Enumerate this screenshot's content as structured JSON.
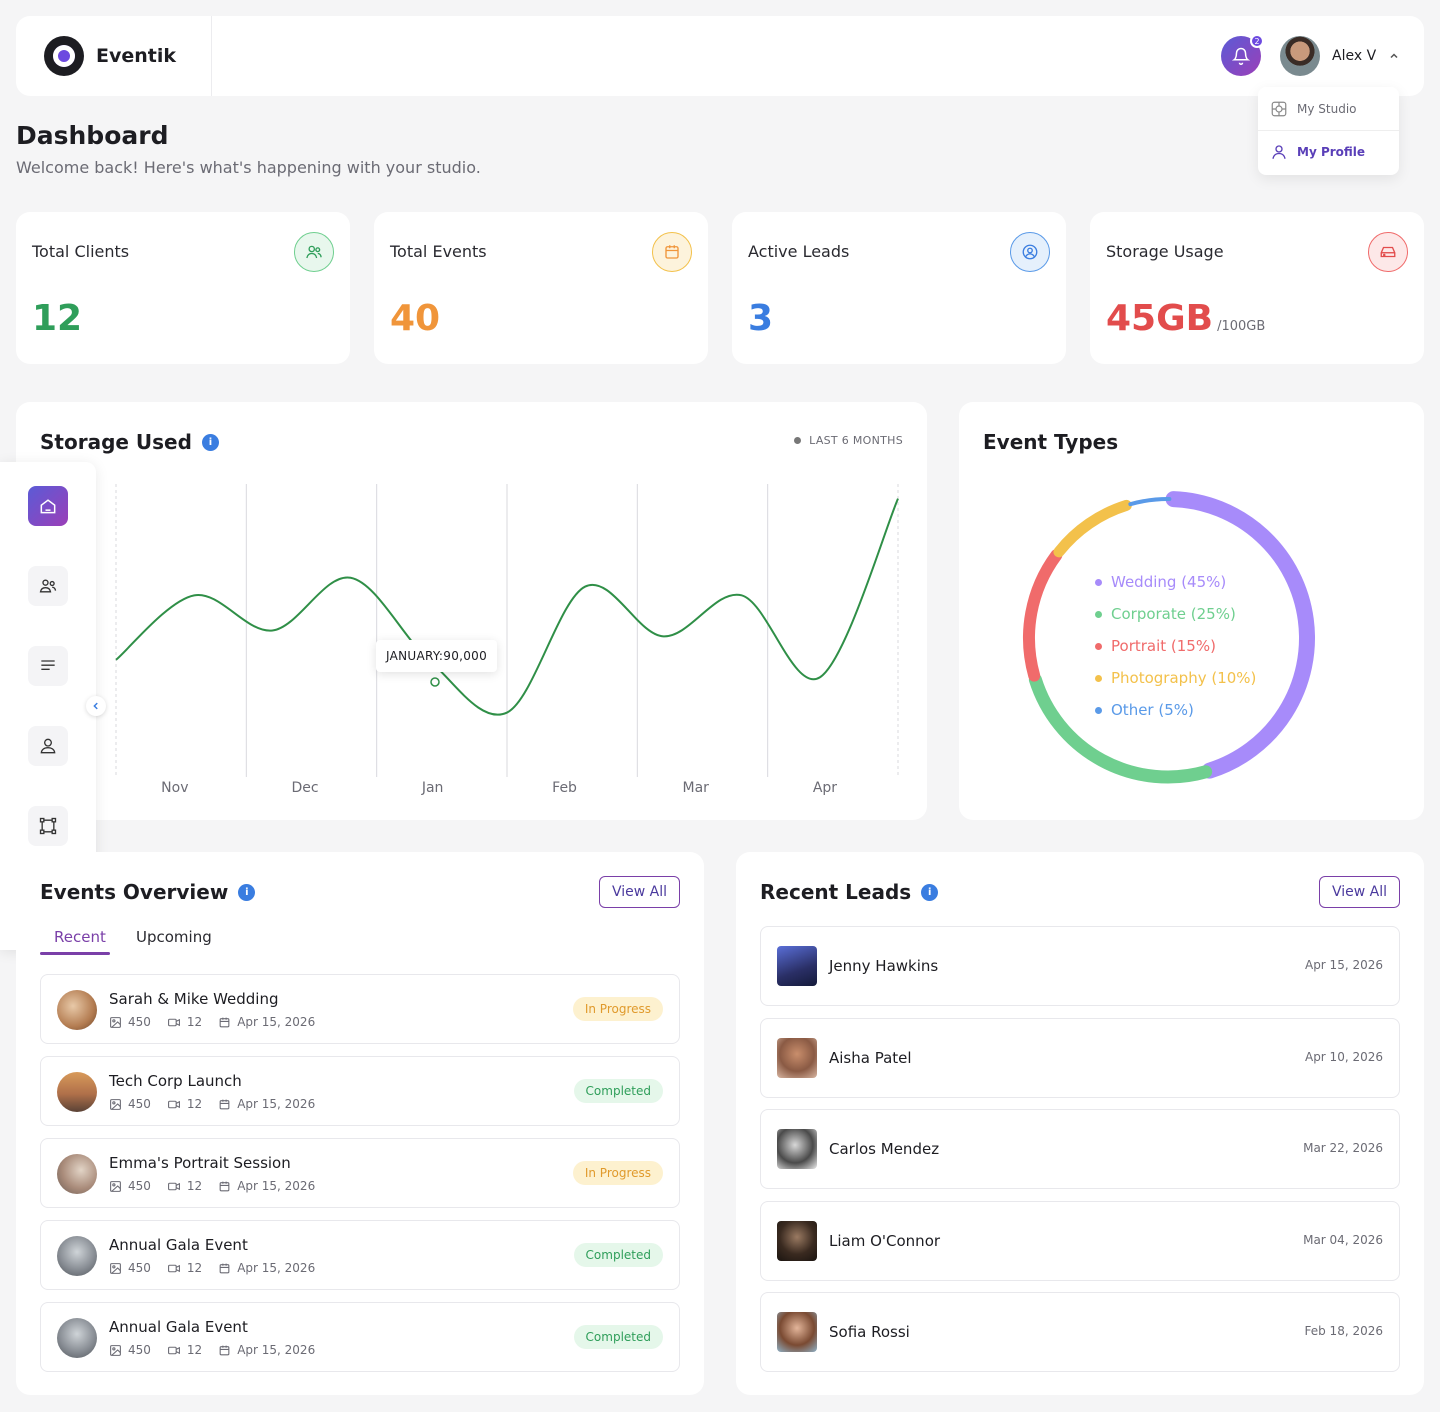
{
  "header": {
    "brand": "Eventik",
    "notification_count": "2",
    "user_name": "Alex V"
  },
  "user_menu": {
    "items": [
      {
        "label": "My Studio",
        "icon": "studio-icon"
      },
      {
        "label": "My Profile",
        "icon": "user-icon",
        "active": true
      }
    ]
  },
  "page": {
    "title": "Dashboard",
    "subtitle": "Welcome back! Here's what's happening with your studio."
  },
  "stats": [
    {
      "label": "Total Clients",
      "value": "12",
      "color": "#2f9e5a",
      "icon": "users-icon"
    },
    {
      "label": "Total Events",
      "value": "40",
      "color": "#f0953a",
      "icon": "calendar-icon"
    },
    {
      "label": "Active Leads",
      "value": "3",
      "color": "#3a7de0",
      "icon": "user-circle-icon"
    },
    {
      "label": "Storage Usage",
      "value": "45GB",
      "unit": "/100GB",
      "color": "#e24c4c",
      "icon": "drive-icon"
    }
  ],
  "storage": {
    "title": "Storage Used",
    "range_label": "LAST 6 MONTHS",
    "tooltip": "JANUARY:90,000"
  },
  "chart_data": {
    "type": "line",
    "title": "Storage Used",
    "categories": [
      "Nov",
      "Dec",
      "Jan",
      "Feb",
      "Mar",
      "Apr"
    ],
    "x": [
      0,
      0.5,
      1,
      1.5,
      2,
      2.5,
      3,
      3.5,
      4,
      4.5,
      5,
      5.5,
      6
    ],
    "y": [
      40,
      62,
      50,
      68,
      40,
      22,
      65,
      48,
      62,
      34,
      95
    ],
    "series_color": "#2f8f47",
    "grid": true,
    "highlight": {
      "category": "Jan",
      "label": "JANUARY:90,000"
    }
  },
  "event_types": {
    "title": "Event Types",
    "segments": [
      {
        "label": "Wedding (45%)",
        "value": 45,
        "color": "#a78bfa"
      },
      {
        "label": "Corporate (25%)",
        "value": 25,
        "color": "#6fcf8f"
      },
      {
        "label": "Portrait (15%)",
        "value": 15,
        "color": "#f06b6b"
      },
      {
        "label": "Photography (10%)",
        "value": 10,
        "color": "#f3c14b"
      },
      {
        "label": "Other (5%)",
        "value": 5,
        "color": "#5a9ae8"
      }
    ]
  },
  "sidebar": {
    "items": [
      {
        "name": "home-icon",
        "active": true
      },
      {
        "name": "clients-icon"
      },
      {
        "name": "menu-icon"
      },
      {
        "name": "profile-icon"
      },
      {
        "name": "frame-icon"
      },
      {
        "name": "calendar-icon"
      }
    ]
  },
  "overview": {
    "title": "Events Overview",
    "view_all": "View All",
    "tabs": [
      "Recent",
      "Upcoming"
    ],
    "rows": [
      {
        "name": "Sarah & Mike Wedding",
        "photos": "450",
        "videos": "12",
        "date": "Apr 15, 2026",
        "status": "In Progress"
      },
      {
        "name": "Tech Corp Launch",
        "photos": "450",
        "videos": "12",
        "date": "Apr 15, 2026",
        "status": "Completed"
      },
      {
        "name": "Emma's Portrait Session",
        "photos": "450",
        "videos": "12",
        "date": "Apr 15, 2026",
        "status": "In Progress"
      },
      {
        "name": "Annual Gala Event",
        "photos": "450",
        "videos": "12",
        "date": "Apr 15, 2026",
        "status": "Completed"
      },
      {
        "name": "Annual Gala Event",
        "photos": "450",
        "videos": "12",
        "date": "Apr 15, 2026",
        "status": "Completed"
      }
    ]
  },
  "leads": {
    "title": "Recent Leads",
    "view_all": "View All",
    "rows": [
      {
        "name": "Jenny Hawkins",
        "date": "Apr 15, 2026"
      },
      {
        "name": "Aisha Patel",
        "date": "Apr 10, 2026"
      },
      {
        "name": "Carlos Mendez",
        "date": "Mar 22, 2026"
      },
      {
        "name": "Liam O'Connor",
        "date": "Mar 04, 2026"
      },
      {
        "name": "Sofia Rossi",
        "date": "Feb 18, 2026"
      }
    ]
  }
}
